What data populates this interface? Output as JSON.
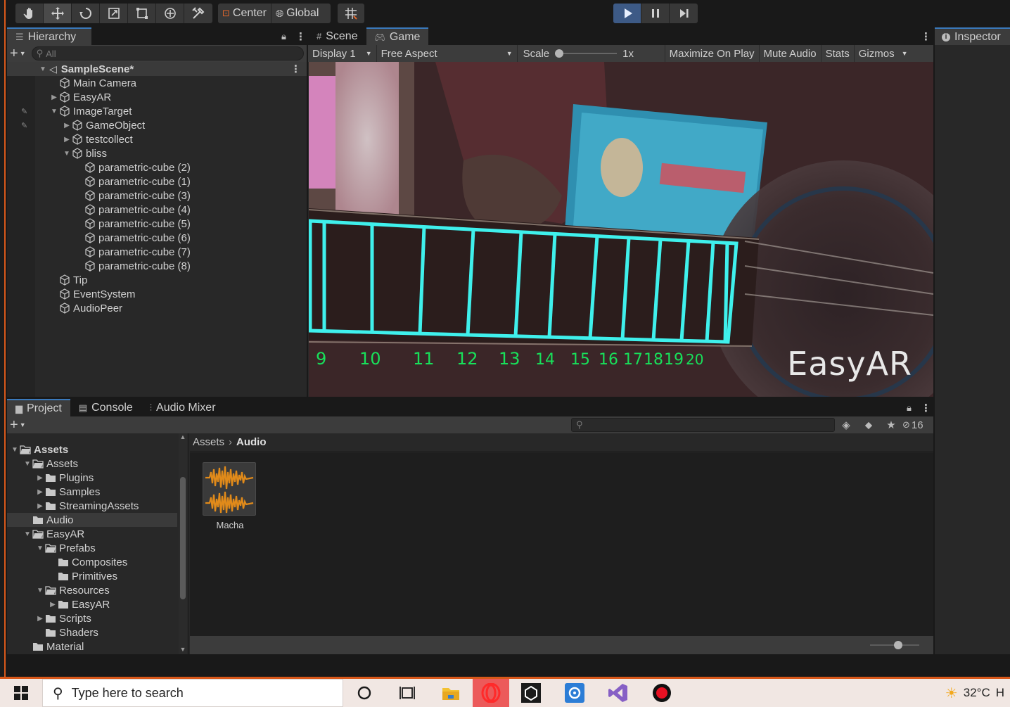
{
  "toolbar": {
    "pivot_label": "Center",
    "space_label": "Global"
  },
  "hierarchy": {
    "tab_label": "Hierarchy",
    "search_placeholder": "All",
    "scene_name": "SampleScene*",
    "items": [
      {
        "label": "Main Camera"
      },
      {
        "label": "EasyAR"
      },
      {
        "label": "ImageTarget"
      },
      {
        "label": "GameObject"
      },
      {
        "label": "testcollect"
      },
      {
        "label": "bliss"
      },
      {
        "label": "parametric-cube (2)"
      },
      {
        "label": "parametric-cube (1)"
      },
      {
        "label": "parametric-cube (3)"
      },
      {
        "label": "parametric-cube (4)"
      },
      {
        "label": "parametric-cube (5)"
      },
      {
        "label": "parametric-cube (6)"
      },
      {
        "label": "parametric-cube (7)"
      },
      {
        "label": "parametric-cube (8)"
      },
      {
        "label": "Tip"
      },
      {
        "label": "EventSystem"
      },
      {
        "label": "AudioPeer"
      }
    ]
  },
  "view_tabs": {
    "scene": "Scene",
    "game": "Game"
  },
  "game_bar": {
    "display": "Display 1",
    "aspect": "Free Aspect",
    "scale_label": "Scale",
    "scale_value": "1x",
    "maximize": "Maximize On Play",
    "mute": "Mute Audio",
    "stats": "Stats",
    "gizmos": "Gizmos"
  },
  "game_view": {
    "fret_numbers": [
      "9",
      "10",
      "11",
      "12",
      "13",
      "14",
      "15",
      "16",
      "17",
      "18",
      "19",
      "20"
    ],
    "watermark": "EasyAR",
    "overlay_color": "#3ff0ec"
  },
  "inspector": {
    "tab_label": "Inspector"
  },
  "bottom_tabs": {
    "project": "Project",
    "console": "Console",
    "audio_mixer": "Audio Mixer"
  },
  "project": {
    "hidden_count": "16",
    "breadcrumb_root": "Assets",
    "breadcrumb_current": "Audio",
    "tree": [
      {
        "label": "Assets"
      },
      {
        "label": "Assets"
      },
      {
        "label": "Plugins"
      },
      {
        "label": "Samples"
      },
      {
        "label": "StreamingAssets"
      },
      {
        "label": "Audio"
      },
      {
        "label": "EasyAR"
      },
      {
        "label": "Prefabs"
      },
      {
        "label": "Composites"
      },
      {
        "label": "Primitives"
      },
      {
        "label": "Resources"
      },
      {
        "label": "EasyAR"
      },
      {
        "label": "Scripts"
      },
      {
        "label": "Shaders"
      },
      {
        "label": "Material"
      }
    ],
    "asset_name": "Macha"
  },
  "taskbar": {
    "search_placeholder": "Type here to search",
    "temperature": "32°C",
    "tray_text": "H"
  }
}
